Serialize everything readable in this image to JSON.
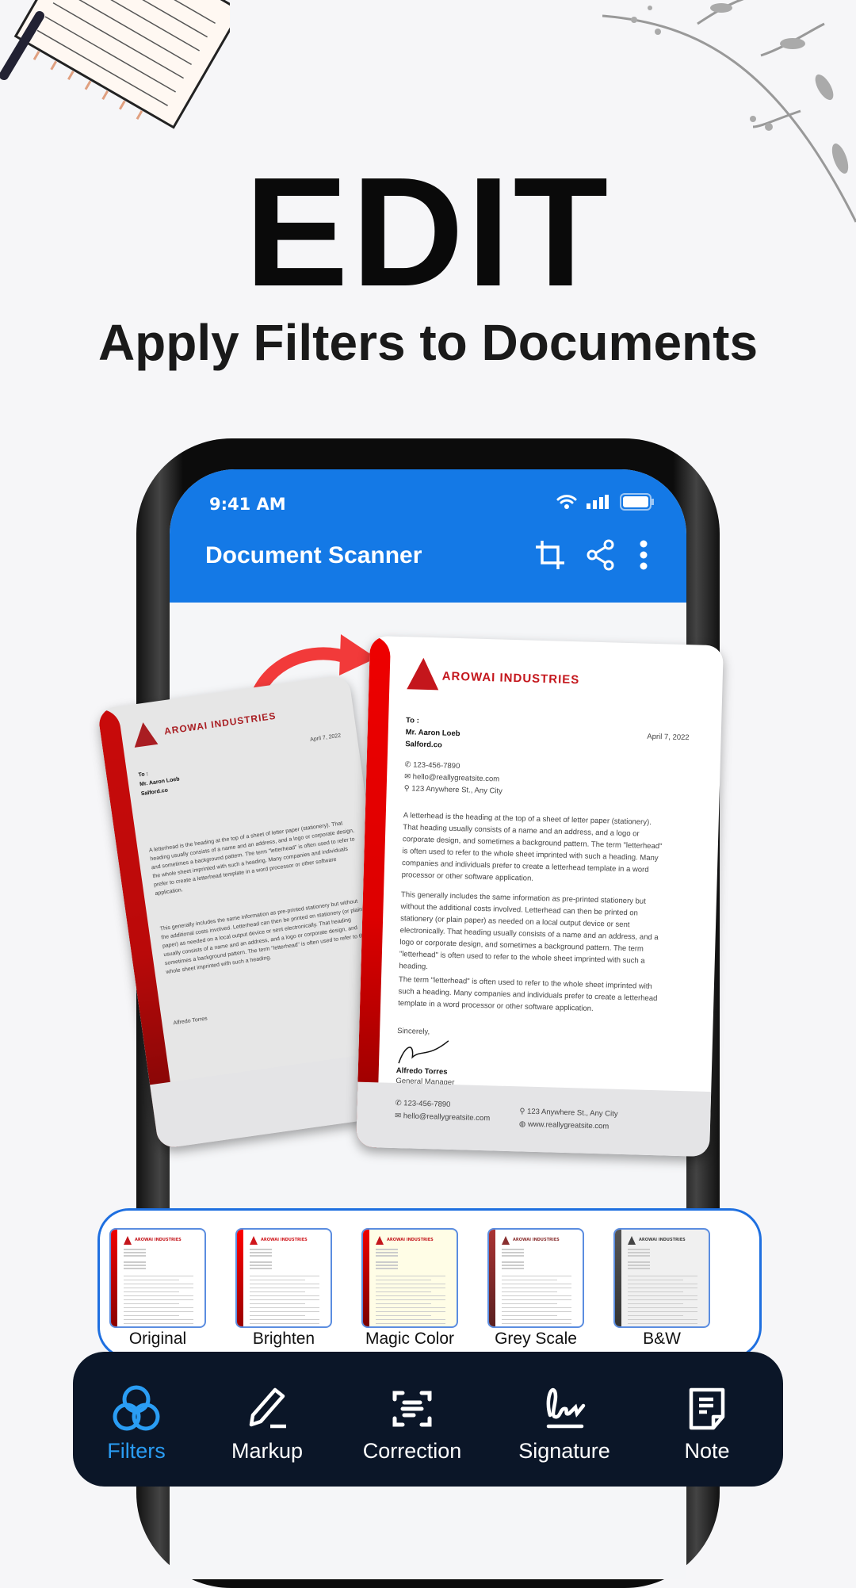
{
  "hero": {
    "title": "EDIT",
    "subtitle": "Apply Filters to Documents"
  },
  "status": {
    "time": "9:41 AM"
  },
  "appbar": {
    "title": "Document Scanner",
    "icons": [
      "crop-icon",
      "share-icon",
      "more-vert-icon"
    ]
  },
  "colors": {
    "appbar": "#1479e6",
    "accent": "#2a9df4",
    "nav_bg": "#0b1628",
    "brand_red": "#c4161c"
  },
  "letter": {
    "brand": "AROWAI INDUSTRIES",
    "to": "To :",
    "name": "Mr. Aaron Loeb",
    "company": "Salford.co",
    "date": "April 7, 2022",
    "phone": "123-456-7890",
    "email": "hello@reallygreatsite.com",
    "address": "123 Anywhere St., Any City",
    "website": "www.reallygreatsite.com",
    "p1": "A letterhead is the heading at the top of a sheet of letter paper (stationery). That heading usually consists of a name and an address, and a logo or corporate design, and sometimes a background pattern. The term \"letterhead\" is often used to refer to the whole sheet imprinted with such a heading. Many companies and individuals prefer to create a letterhead template in a word processor or other software application.",
    "p2": "This generally includes the same information as pre-printed stationery but without the additional costs involved. Letterhead can then be printed on stationery (or plain paper) as needed on a local output device or sent electronically. That heading usually consists of a name and an address, and a logo or corporate design, and sometimes a background pattern. The term \"letterhead\" is often used to refer to the whole sheet imprinted with such a heading.",
    "p3": "The term \"letterhead\" is often used to refer to the whole sheet imprinted with such a heading. Many companies and individuals prefer to create a letterhead template in a word processor or other software application.",
    "closing": "Sincerely,",
    "signer": "Alfredo Torres",
    "title": "General Manager"
  },
  "filters": [
    {
      "label": "Original"
    },
    {
      "label": "Brighten"
    },
    {
      "label": "Magic Color"
    },
    {
      "label": "Grey Scale"
    },
    {
      "label": "B&W"
    }
  ],
  "nav": [
    {
      "label": "Filters",
      "icon": "filters-icon",
      "active": true
    },
    {
      "label": "Markup",
      "icon": "pencil-icon"
    },
    {
      "label": "Correction",
      "icon": "scan-text-icon"
    },
    {
      "label": "Signature",
      "icon": "signature-icon"
    },
    {
      "label": "Note",
      "icon": "note-icon"
    }
  ]
}
